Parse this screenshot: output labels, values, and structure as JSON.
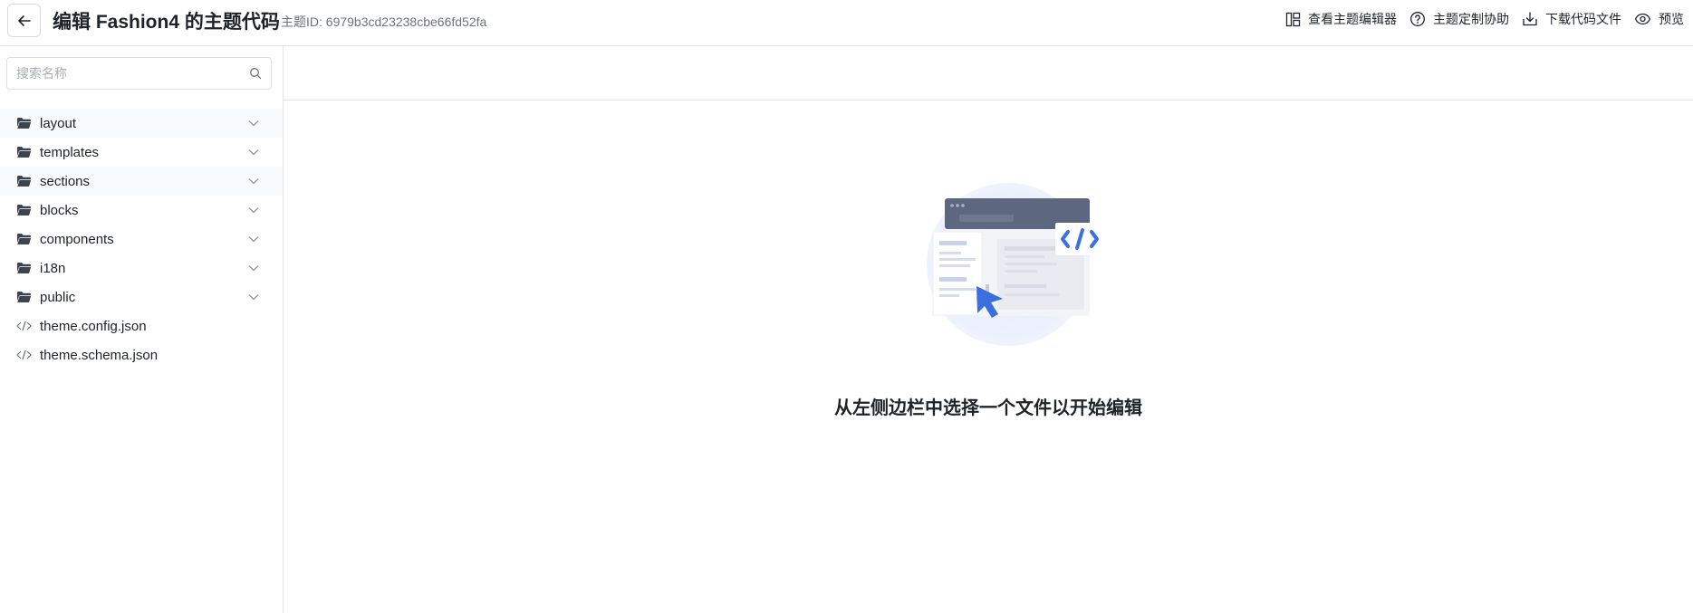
{
  "header": {
    "back_icon": "arrow-left-icon",
    "title": "编辑 Fashion4 的主题代码",
    "theme_id": "主题ID: 6979b3cd23238cbe66fd52fa",
    "actions": [
      {
        "label": "查看主题编辑器",
        "icon": "layout-panels-icon"
      },
      {
        "label": "主题定制协助",
        "icon": "help-circle-icon"
      },
      {
        "label": "下载代码文件",
        "icon": "download-icon"
      },
      {
        "label": "预览",
        "icon": "eye-icon"
      }
    ]
  },
  "sidebar": {
    "search_placeholder": "搜索名称",
    "items": [
      {
        "label": "layout",
        "type": "folder"
      },
      {
        "label": "templates",
        "type": "folder"
      },
      {
        "label": "sections",
        "type": "folder"
      },
      {
        "label": "blocks",
        "type": "folder"
      },
      {
        "label": "components",
        "type": "folder"
      },
      {
        "label": "i18n",
        "type": "folder"
      },
      {
        "label": "public",
        "type": "folder"
      },
      {
        "label": "theme.config.json",
        "type": "file"
      },
      {
        "label": "theme.schema.json",
        "type": "file"
      }
    ]
  },
  "main": {
    "empty_message": "从左侧边栏中选择一个文件以开始编辑"
  },
  "colors": {
    "accent": "#3b6fe0",
    "border": "#e3e5e8",
    "text": "#1f2329",
    "muted": "#6b7280"
  }
}
